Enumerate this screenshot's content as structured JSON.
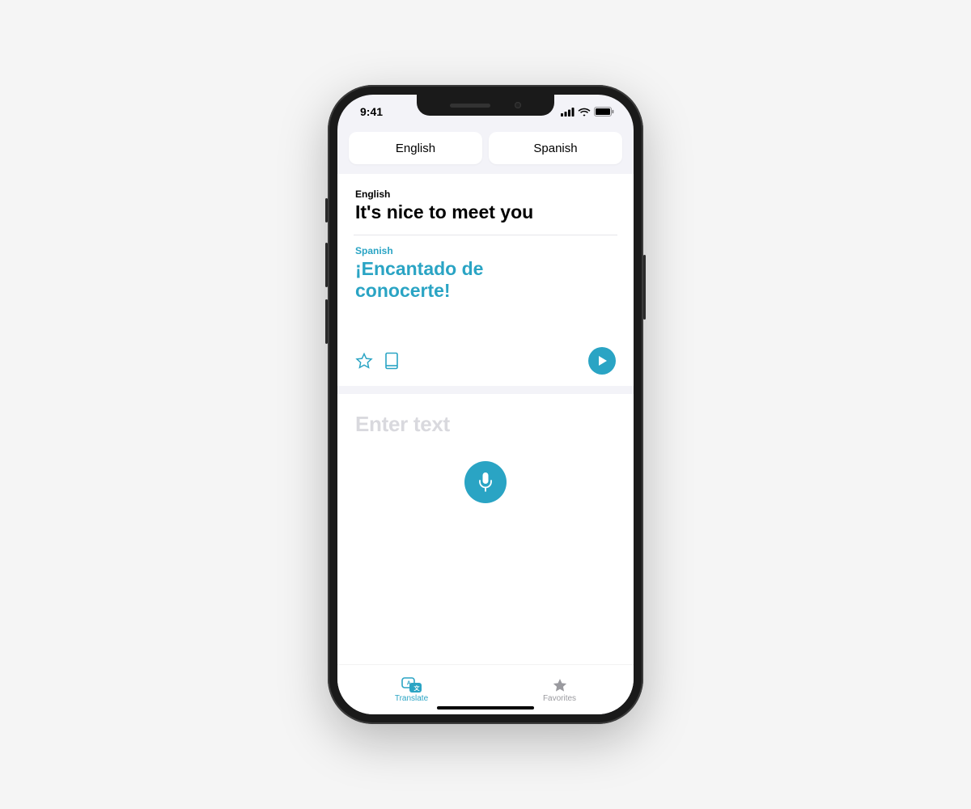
{
  "status": {
    "time": "9:41"
  },
  "languages": {
    "source": "English",
    "target": "Spanish"
  },
  "translation": {
    "source_label": "English",
    "source_text": "It's nice to meet you",
    "target_label": "Spanish",
    "target_text": "¡Encantado de conocerte!"
  },
  "input": {
    "placeholder": "Enter text"
  },
  "tabs": {
    "translate": "Translate",
    "favorites": "Favorites"
  },
  "colors": {
    "accent": "#2aa4c4",
    "inactive": "#9a9a9f"
  }
}
